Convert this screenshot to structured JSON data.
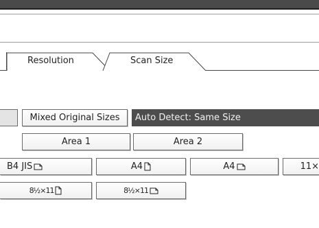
{
  "tabs": [
    {
      "label": "Resolution",
      "active": false
    },
    {
      "label": "Scan Size",
      "active": true
    }
  ],
  "mixed_original_sizes_label": "Mixed Original Sizes",
  "auto_detect_status": "Auto Detect: Same Size",
  "area_buttons": [
    {
      "label": "Area 1"
    },
    {
      "label": "Area 2"
    }
  ],
  "size_buttons_row1": [
    {
      "label": "B4 JIS",
      "icon": "landscape-paper-icon"
    },
    {
      "label": "A4",
      "icon": "portrait-paper-icon"
    },
    {
      "label": "A4",
      "icon": "landscape-paper-icon"
    },
    {
      "label": "11×",
      "icon": ""
    }
  ],
  "size_buttons_row2": [
    {
      "label": "8½×11",
      "icon": "portrait-paper-icon"
    },
    {
      "label": "8½×11",
      "icon": "landscape-paper-icon"
    }
  ],
  "colors": {
    "title_bar": "#4a4a4a",
    "status_bar": "#4d4d4d",
    "status_text": "#f2f2f2"
  }
}
